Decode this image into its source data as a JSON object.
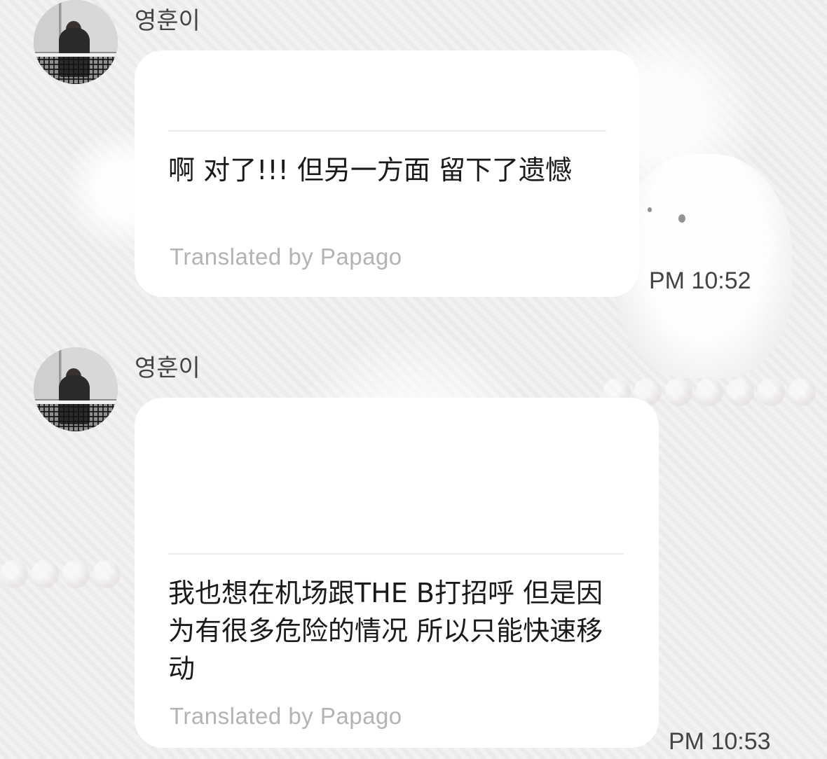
{
  "messages": [
    {
      "sender": "영훈이",
      "text": "啊 对了!!!  但另一方面 留下了遗憾",
      "translated_by": "Translated by Papago",
      "time": "PM 10:52"
    },
    {
      "sender": "영훈이",
      "text": "我也想在机场跟THE B打招呼 但是因为有很多危险的情况 所以只能快速移动",
      "translated_by": "Translated by Papago",
      "time": "PM 10:53"
    }
  ]
}
